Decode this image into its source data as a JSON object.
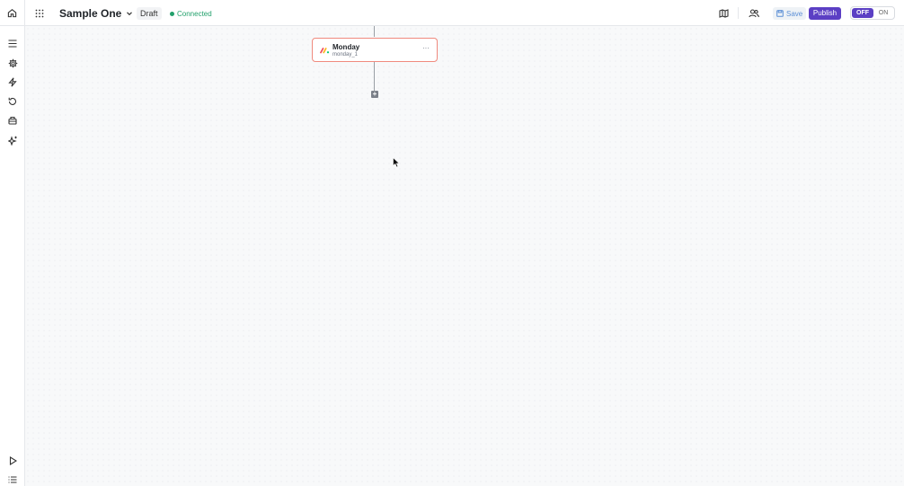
{
  "header": {
    "title": "Sample One",
    "status_badge": "Draft",
    "connection_status": "Connected",
    "save_label": "Save",
    "publish_label": "Publish",
    "toggle_off_label": "OFF",
    "toggle_on_label": "ON",
    "toggle_state": "OFF"
  },
  "sidebar": {
    "top_items": [
      "menu-icon",
      "settings-icon",
      "lightning-icon",
      "history-icon",
      "bucket-icon",
      "sparkle-icon"
    ],
    "bottom_items": [
      "play-icon",
      "list-icon"
    ]
  },
  "workflow": {
    "node": {
      "title": "Monday",
      "subtitle": "monday_1",
      "more": "···",
      "icon": "monday-logo"
    },
    "add_step_label": "+"
  },
  "colors": {
    "accent": "#5b3fc4",
    "connected": "#22a06b",
    "node_border": "#f08a7e",
    "save_text": "#5b8fd6"
  }
}
